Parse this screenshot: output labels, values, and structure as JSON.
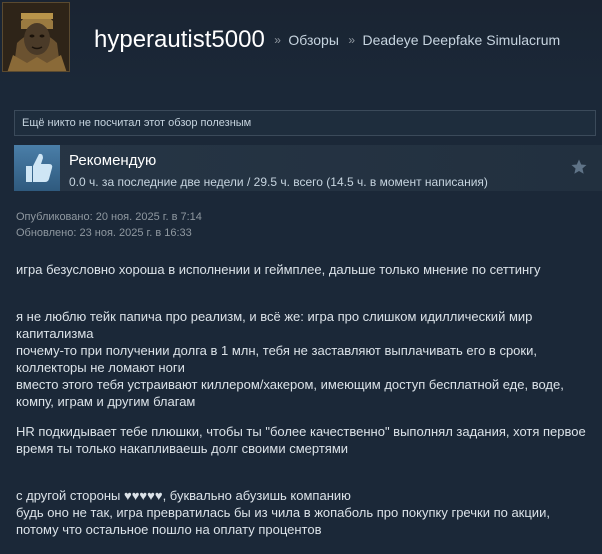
{
  "header": {
    "username": "hyperautist5000",
    "separator": "»",
    "crumb_reviews": "Обзоры",
    "crumb_game": "Deadeye Deepfake Simulacrum"
  },
  "helpful": {
    "text": "Ещё никто не посчитал этот обзор полезным"
  },
  "recommendation": {
    "title": "Рекомендую",
    "hours": "0.0 ч. за последние две недели / 29.5 ч. всего (14.5 ч. в момент написания)"
  },
  "dates": {
    "published": "Опубликовано: 20 ноя. 2025 г. в 7:14",
    "updated": "Обновлено: 23 ноя. 2025 г. в 16:33"
  },
  "review": {
    "p1": "игра безусловно хороша в исполнении и геймплее, дальше только мнение по сеттингу",
    "p2a": "я не люблю тейк папича про реализм, и всё же: игра про слишком идиллический мир капитализма",
    "p2b": "почему-то при получении долга в 1 млн, тебя не заставляют выплачивать его в сроки, коллекторы не ломают ноги",
    "p2c": "вместо этого тебя устраивают киллером/хакером, имеющим доступ бесплатной еде, воде, компу, играм и другим благам",
    "p3": "HR подкидывает тебе плюшки, чтобы ты \"более качественно\" выполнял задания, хотя первое время ты только накапливаешь долг своими смертями",
    "p4a": "с другой стороны ♥♥♥♥♥, буквально абузишь компанию",
    "p4b": "будь оно не так, игра превратилась бы из чила в жопаболь про покупку гречки по акции, потому что остальное пошло на оплату процентов"
  }
}
